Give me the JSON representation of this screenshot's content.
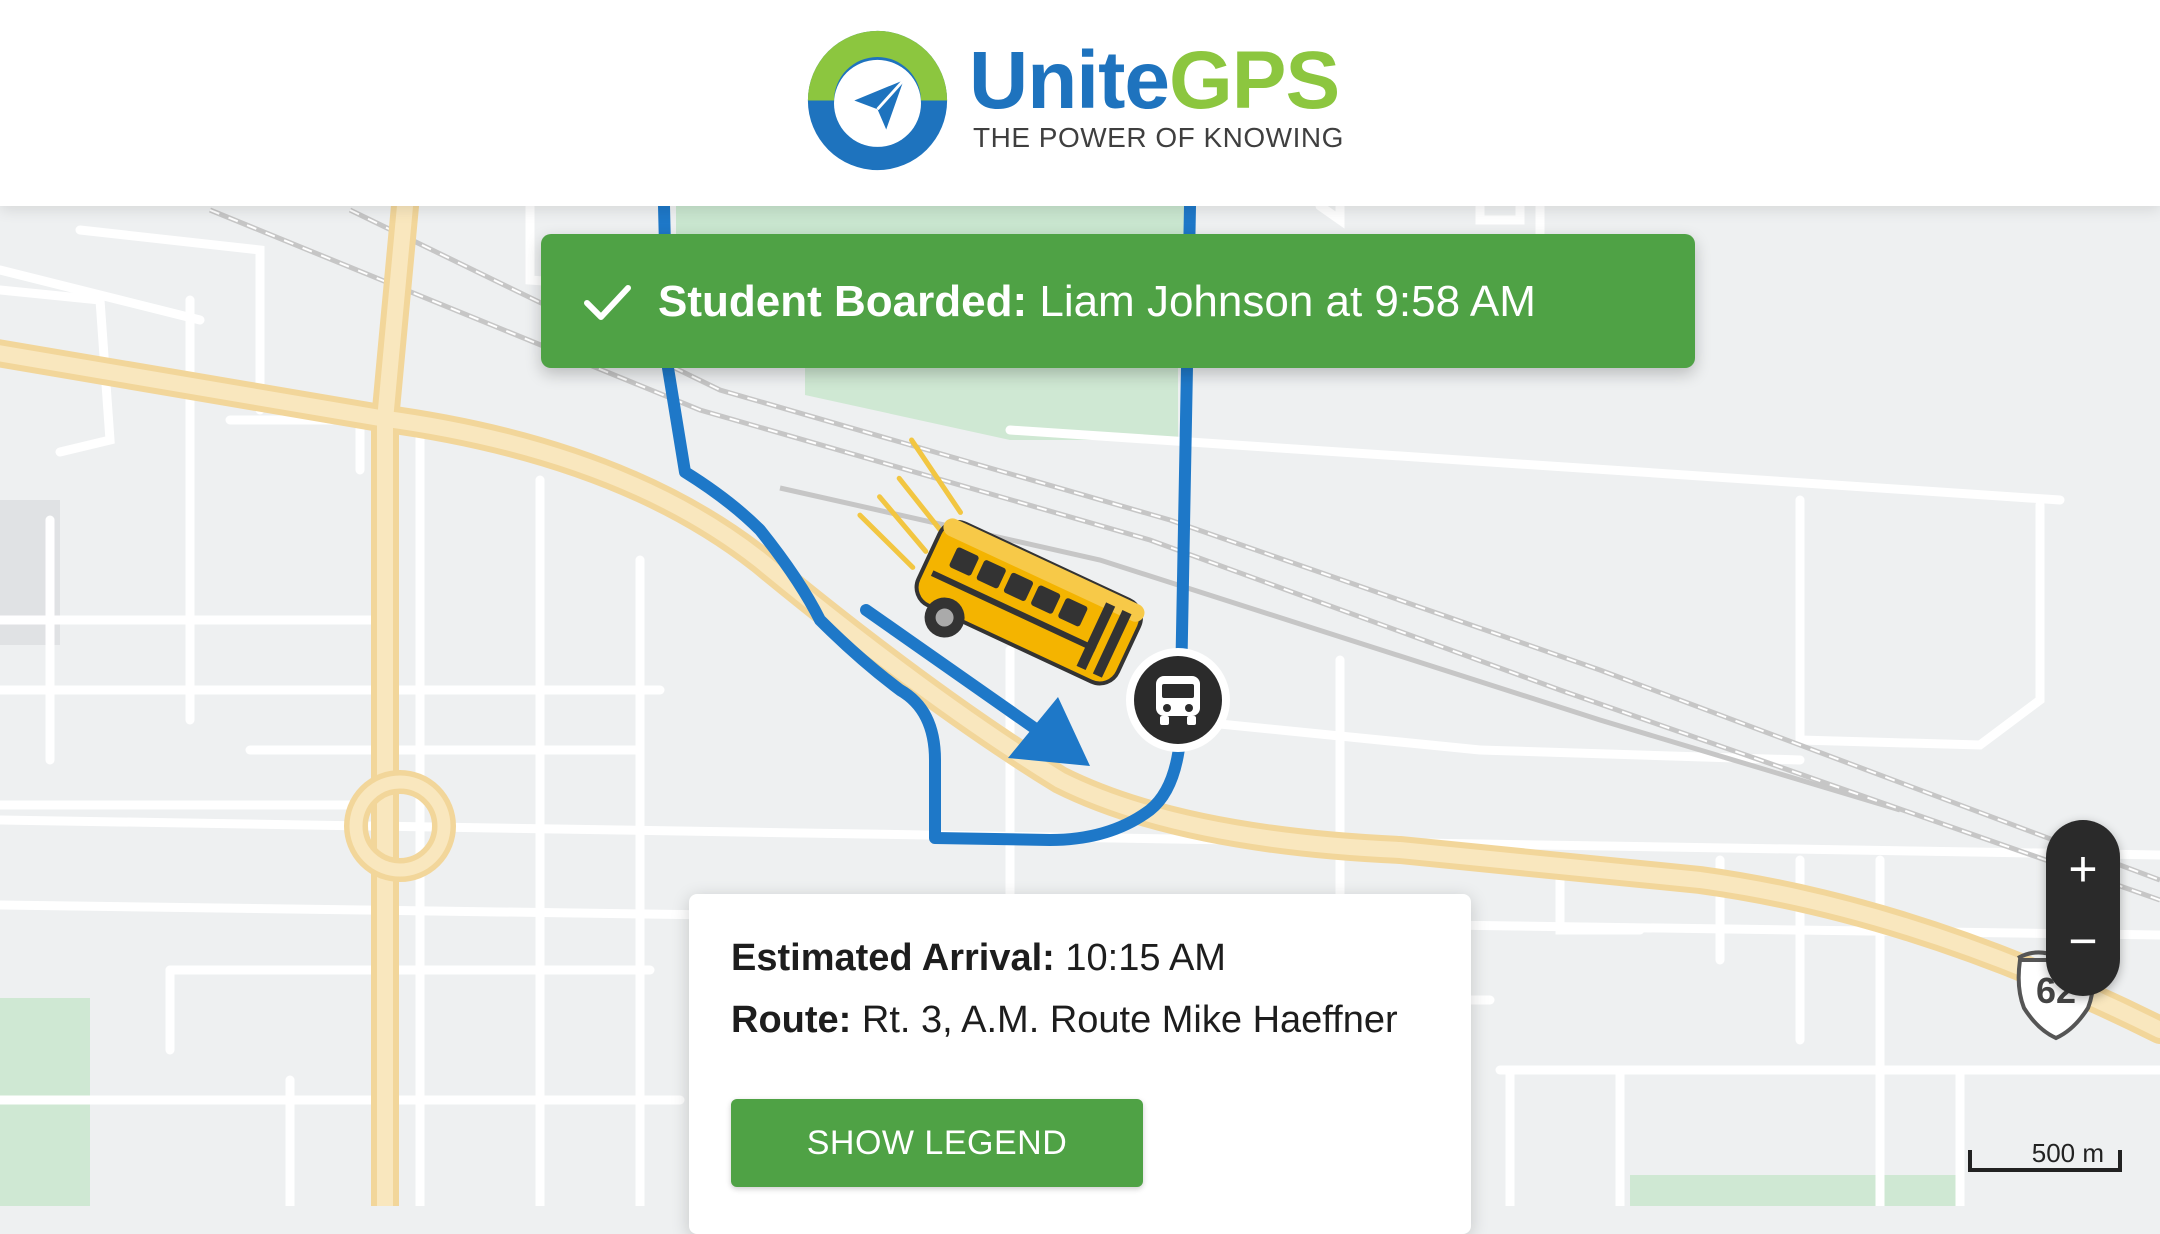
{
  "brand": {
    "name_part1": "Unite",
    "name_part2": "GPS",
    "tagline": "THE POWER OF KNOWING",
    "colors": {
      "blue": "#1e73be",
      "green": "#8cc63f"
    },
    "icon": "paper-plane-icon"
  },
  "notification": {
    "icon": "check-icon",
    "label": "Student Boarded:",
    "message": "Liam Johnson at 9:58 AM",
    "color": "#4fa245"
  },
  "info_card": {
    "arrival_label": "Estimated Arrival:",
    "arrival_value": "10:15 AM",
    "route_label": "Route:",
    "route_value": "Rt. 3, A.M. Route Mike Haeffner",
    "button_label": "SHOW LEGEND"
  },
  "map": {
    "highway_shield": "62",
    "scale_label": "500 m",
    "route_color": "#1e78c8",
    "bus_marker_icon": "bus-icon",
    "vehicle_icon": "school-bus-icon"
  },
  "zoom": {
    "in_label": "+",
    "out_label": "−"
  }
}
